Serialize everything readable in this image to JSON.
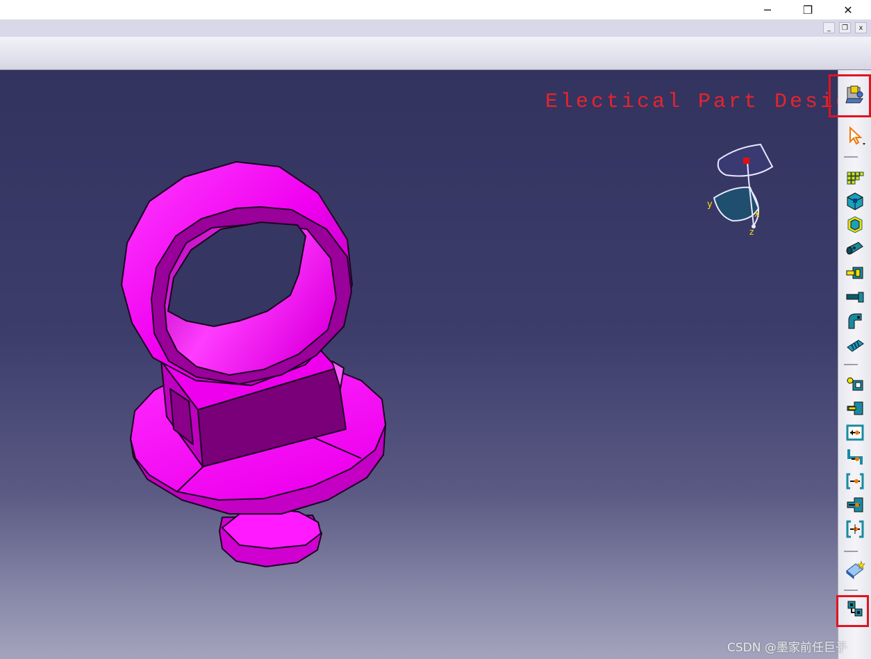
{
  "window": {
    "minimize_glyph": "─",
    "restore_glyph": "❐",
    "close_glyph": "✕"
  },
  "mdi": {
    "minimize_glyph": "_",
    "restore_glyph": "❐",
    "close_glyph": "x"
  },
  "viewport": {
    "workbench_label": "Electical Part Design",
    "compass": {
      "axis_x": "x",
      "axis_y": "y",
      "axis_z": "z"
    }
  },
  "right_toolbar": {
    "icons": [
      "workbench-icon",
      "select-icon",
      "geometrical-bundle-icon",
      "device-cube-icon",
      "device-frame-icon",
      "cylinder-device-icon",
      "connector-icon",
      "cylinder-plug-icon",
      "elbow-device-icon",
      "spring-device-icon",
      "add-connection-point-icon",
      "connection-point-icon",
      "bundle-connection-point-icon",
      "cavity-connection-point-icon",
      "bundle-connection-point-2-icon",
      "connector-connection-point-icon",
      "mounting-point-icon",
      "define-part-icon",
      "link-devices-icon"
    ]
  },
  "colors": {
    "part": "#ff00ff",
    "highlight": "#e0141e",
    "label": "#e8232d"
  },
  "watermark": "CSDN @墨家前任巨子"
}
